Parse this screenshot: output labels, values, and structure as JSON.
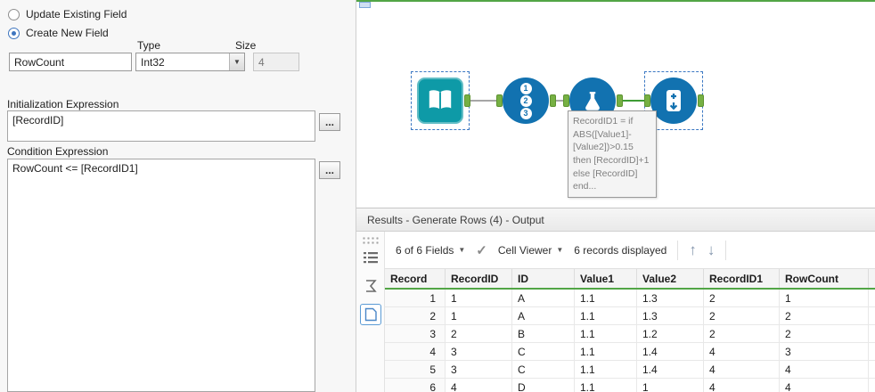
{
  "config": {
    "radios": [
      {
        "label": "Update Existing Field",
        "selected": false
      },
      {
        "label": "Create New Field",
        "selected": true
      }
    ],
    "field_name_value": "RowCount",
    "type_label": "Type",
    "type_value": "Int32",
    "size_label": "Size",
    "size_value": "4",
    "init_label": "Initialization Expression",
    "init_value": "[RecordID]",
    "cond_label": "Condition Expression",
    "cond_value": "RowCount <= [RecordID1]",
    "browse_label": "..."
  },
  "canvas": {
    "tools": [
      {
        "name": "Input Data"
      },
      {
        "name": "RecordID",
        "digits": [
          "1",
          "2",
          "3"
        ]
      },
      {
        "name": "Formula"
      },
      {
        "name": "Generate Rows"
      }
    ],
    "tooltip_text": "RecordID1 = if ABS([Value1]-[Value2])>0.15 then [RecordID]+1 else [RecordID] end..."
  },
  "results": {
    "title": "Results - Generate Rows (4) - Output",
    "toolbar": {
      "fields_label": "6 of 6 Fields",
      "check_glyph": "✓",
      "cell_viewer_label": "Cell Viewer",
      "records_label": "6 records displayed",
      "up_arrow": "↑",
      "down_arrow": "↓",
      "caret": "▼"
    },
    "table": {
      "columns": [
        "Record",
        "RecordID",
        "ID",
        "Value1",
        "Value2",
        "RecordID1",
        "RowCount"
      ],
      "rows": [
        [
          "1",
          "1",
          "A",
          "1.1",
          "1.3",
          "2",
          "1"
        ],
        [
          "2",
          "1",
          "A",
          "1.1",
          "1.3",
          "2",
          "2"
        ],
        [
          "3",
          "2",
          "B",
          "1.1",
          "1.2",
          "2",
          "2"
        ],
        [
          "4",
          "3",
          "C",
          "1.1",
          "1.4",
          "4",
          "3"
        ],
        [
          "5",
          "3",
          "C",
          "1.1",
          "1.4",
          "4",
          "4"
        ],
        [
          "6",
          "4",
          "D",
          "1.1",
          "1",
          "4",
          "4"
        ]
      ]
    }
  },
  "colors": {
    "tool_blue": "#1272b0",
    "tool_teal": "#0e9aa7",
    "connector_green": "#76b043",
    "accent_green": "#52a546",
    "selection_blue": "#3b78c3"
  }
}
